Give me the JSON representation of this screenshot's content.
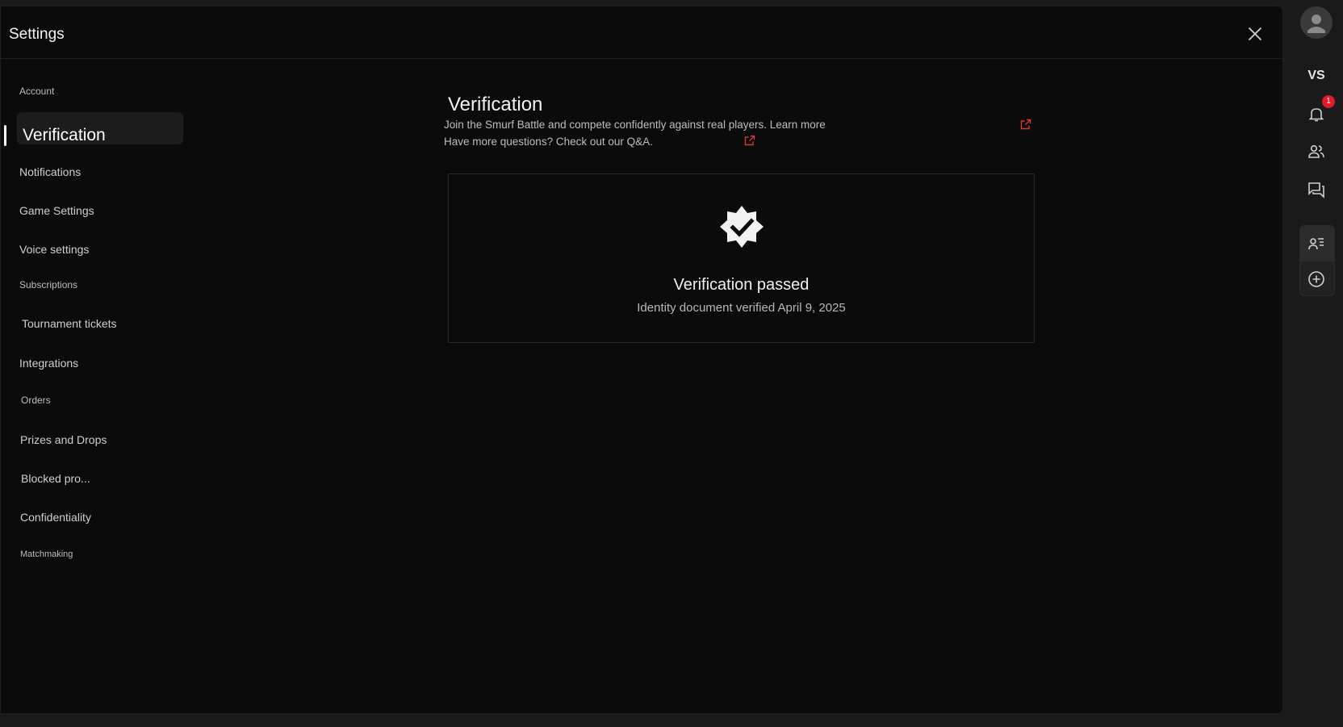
{
  "modal": {
    "title": "Settings"
  },
  "sidebar": {
    "items": [
      {
        "id": "account",
        "label": "Account"
      },
      {
        "id": "verification",
        "label": "Verification",
        "active": true
      },
      {
        "id": "notifications",
        "label": "Notifications"
      },
      {
        "id": "game-settings",
        "label": "Game Settings"
      },
      {
        "id": "voice-settings",
        "label": "Voice settings"
      },
      {
        "id": "subscriptions",
        "label": "Subscriptions"
      },
      {
        "id": "tournament-tickets",
        "label": "Tournament tickets"
      },
      {
        "id": "integrations",
        "label": "Integrations"
      },
      {
        "id": "orders",
        "label": "Orders"
      },
      {
        "id": "prizes-and-drops",
        "label": "Prizes and Drops"
      },
      {
        "id": "blocked-profiles",
        "label": "Blocked pro..."
      },
      {
        "id": "confidentiality",
        "label": "Confidentiality"
      },
      {
        "id": "matchmaking",
        "label": "Matchmaking"
      }
    ]
  },
  "content": {
    "title": "Verification",
    "description_line1": "Join the Smurf Battle and compete confidently against real players. Learn more",
    "description_line2": "Have more questions? Check out our Q&A."
  },
  "status_card": {
    "title": "Verification passed",
    "subtitle": "Identity document verified April 9, 2025"
  },
  "rail": {
    "vs_label": "VS",
    "notification_count": "1"
  },
  "colors": {
    "background": "#0b0b0b",
    "rail_background": "#1a1a1a",
    "accent_red": "#e01b2b",
    "link_red": "#d9363e"
  }
}
